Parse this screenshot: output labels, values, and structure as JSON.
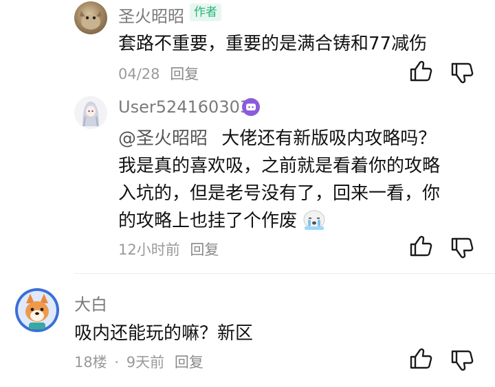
{
  "comments": [
    {
      "author": "圣火昭昭",
      "badge": "作者",
      "text": "套路不重要，重要的是满合铸和77减伤",
      "date": "04/28",
      "reply_label": "回复"
    },
    {
      "author": "User524160303",
      "mention": "@圣火昭昭",
      "text_lines": [
        "大佬还有新版吸内攻略吗？",
        "我是真的喜欢吸，之前就是看着你的攻略",
        "入坑的，但是老号没有了，回来一看，你",
        "的攻略上也挂了个作废"
      ],
      "emoji": "sob-seal-emoji",
      "time": "12小时前",
      "reply_label": "回复"
    },
    {
      "author": "大白",
      "text": "吸内还能玩的嘛？新区",
      "floor": "18楼",
      "separator": "·",
      "time": "9天前",
      "reply_label": "回复"
    }
  ],
  "colors": {
    "author_badge_bg": "#e6f7ef",
    "author_badge_text": "#28b37a",
    "meta_gray": "#9a9a9a",
    "user_badge": "#8a5bdc"
  },
  "icons": [
    "thumbs-up-icon",
    "thumbs-down-icon"
  ]
}
